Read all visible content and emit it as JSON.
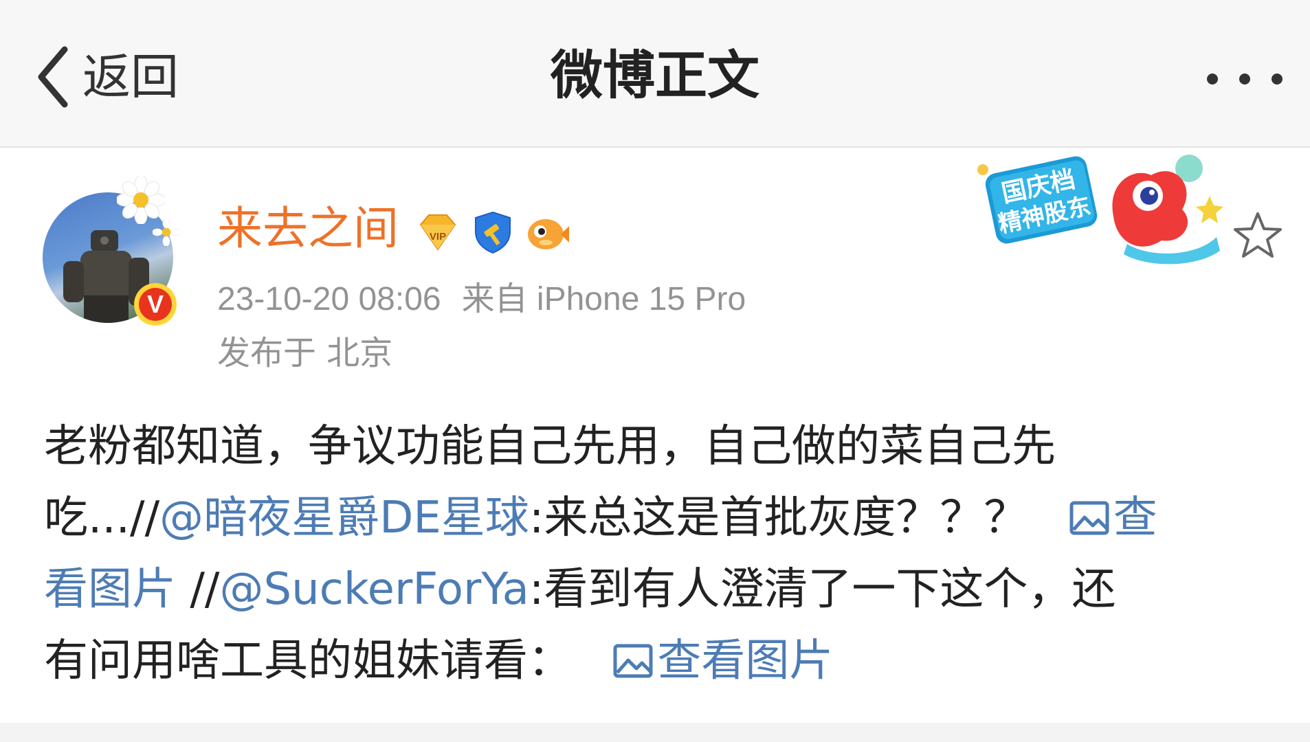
{
  "nav": {
    "back_label": "返回",
    "title": "微博正文"
  },
  "author": {
    "name": "来去之间",
    "badges": [
      "vip-diamond-icon",
      "blue-shield-icon",
      "pufferfish-icon"
    ],
    "timestamp": "23-10-20 08:06",
    "source": "来自 iPhone 15 Pro",
    "location": "发布于 北京"
  },
  "promo": {
    "line1": "国庆档",
    "line2": "精神股东"
  },
  "post": {
    "seg1": "老粉都知道，争议功能自己先用，自己做的菜自己先",
    "seg2a": "吃...//",
    "mention1": "@暗夜星爵DE星球",
    "seg2b": ":来总这是首批灰度？？？",
    "link1": "查",
    "link1b": "看图片",
    "seg3a": " //",
    "mention2": "@SuckerForYa",
    "seg3b": ":看到有人澄清了一下这个，还",
    "seg4a": "有问用啥工具的姐妹请看：",
    "link2": "查看图片"
  },
  "colors": {
    "accent_name": "#ee7128",
    "link": "#4d7cb5",
    "meta": "#939393"
  }
}
